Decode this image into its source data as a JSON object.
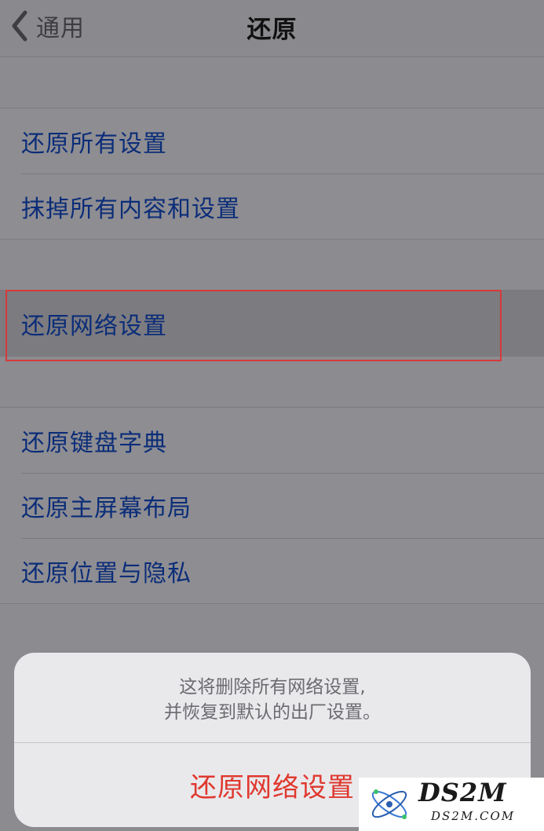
{
  "nav": {
    "back_label": "通用",
    "title": "还原"
  },
  "groups": [
    {
      "items": [
        {
          "label": "还原所有设置"
        },
        {
          "label": "抹掉所有内容和设置"
        }
      ]
    },
    {
      "items": [
        {
          "label": "还原网络设置",
          "highlighted": true
        }
      ]
    },
    {
      "items": [
        {
          "label": "还原键盘字典"
        },
        {
          "label": "还原主屏幕布局"
        },
        {
          "label": "还原位置与隐私"
        }
      ]
    }
  ],
  "action_sheet": {
    "message_line1": "这将删除所有网络设置,",
    "message_line2": "并恢复到默认的出厂设置。",
    "confirm_label": "还原网络设置"
  },
  "watermark": {
    "brand": "DS2M",
    "domain": "DS2M.COM"
  },
  "colors": {
    "link_blue": "#0b2d78",
    "destructive_red": "#e0382e",
    "highlight_border": "#d63a3a"
  }
}
